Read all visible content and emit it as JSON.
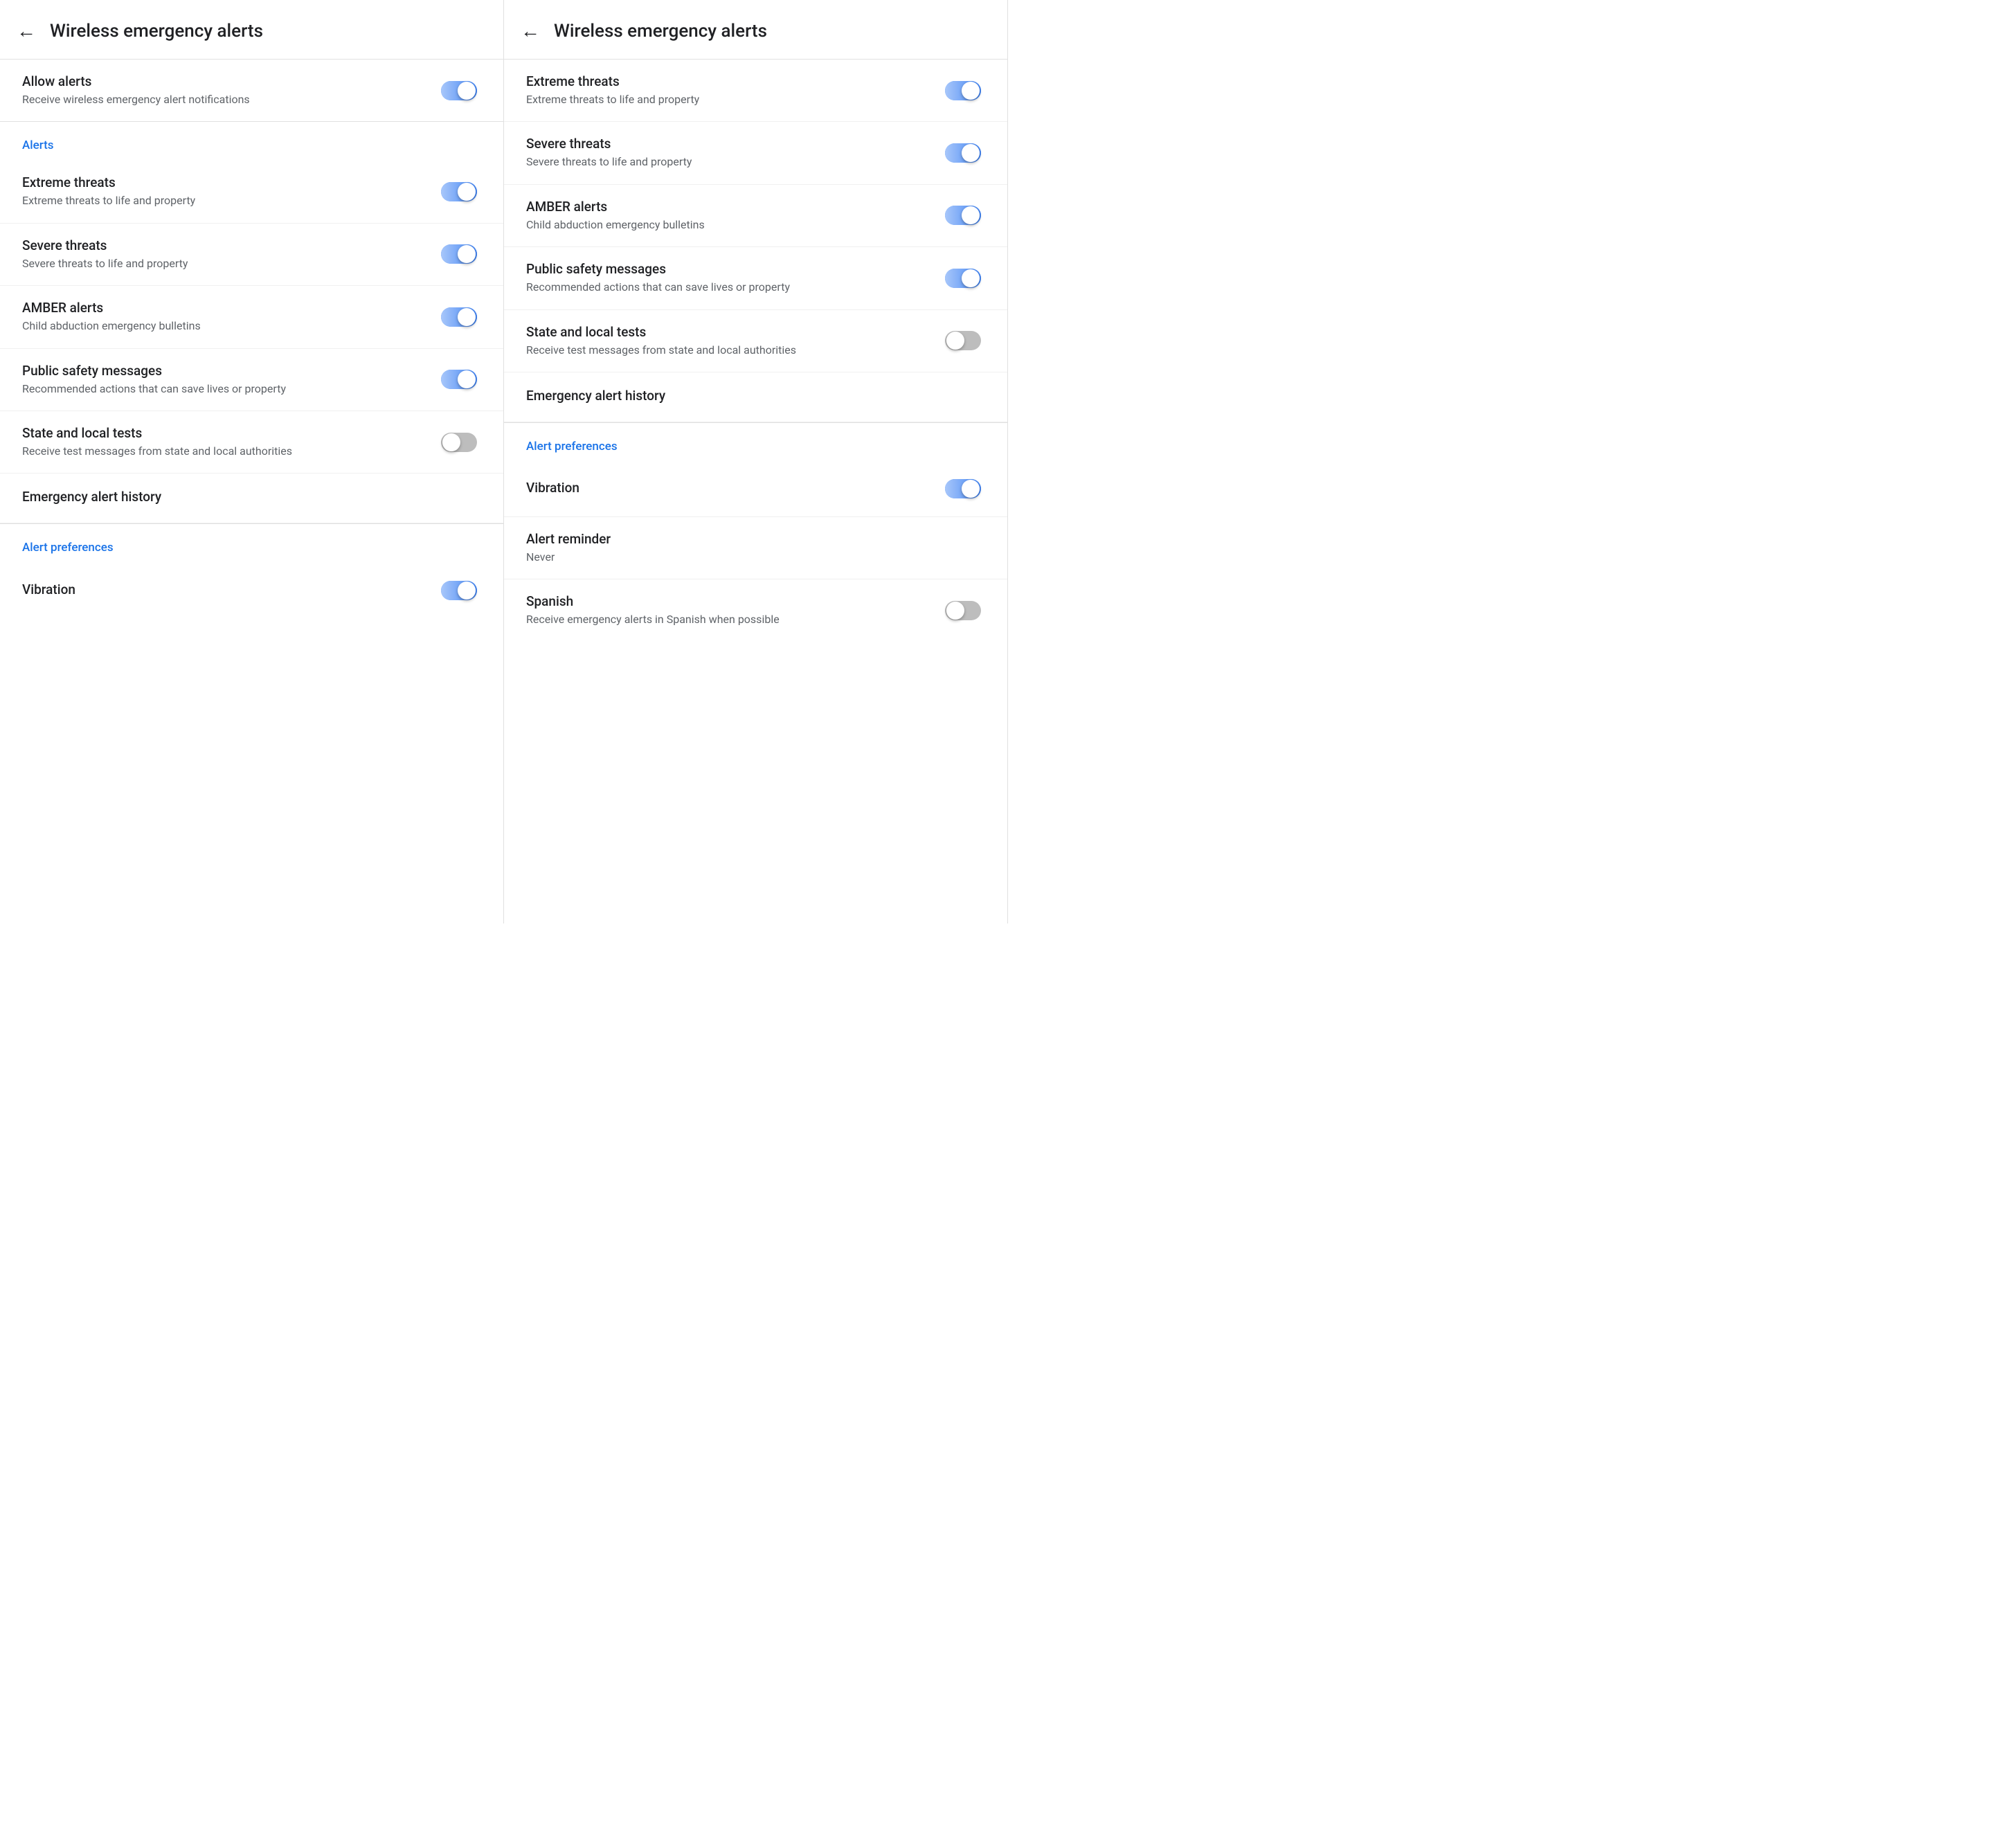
{
  "panels": [
    {
      "id": "panel-left",
      "header": {
        "back_label": "←",
        "title": "Wireless emergency alerts"
      },
      "sections": [
        {
          "id": "allow-section",
          "rows": [
            {
              "id": "allow-alerts",
              "title": "Allow alerts",
              "desc": "Receive wireless emergency alert notifications",
              "toggle": true,
              "toggle_on": true
            }
          ]
        },
        {
          "id": "alerts-section",
          "label": "Alerts",
          "rows": [
            {
              "id": "extreme-threats",
              "title": "Extreme threats",
              "desc": "Extreme threats to life and property",
              "toggle": true,
              "toggle_on": true
            },
            {
              "id": "severe-threats",
              "title": "Severe threats",
              "desc": "Severe threats to life and property",
              "toggle": true,
              "toggle_on": true
            },
            {
              "id": "amber-alerts",
              "title": "AMBER alerts",
              "desc": "Child abduction emergency bulletins",
              "toggle": true,
              "toggle_on": true
            },
            {
              "id": "public-safety",
              "title": "Public safety messages",
              "desc": "Recommended actions that can save lives or property",
              "toggle": true,
              "toggle_on": true
            },
            {
              "id": "state-local-tests",
              "title": "State and local tests",
              "desc": "Receive test messages from state and local authorities",
              "toggle": true,
              "toggle_on": false
            },
            {
              "id": "emergency-history",
              "title": "Emergency alert history",
              "desc": null,
              "toggle": false
            }
          ]
        },
        {
          "id": "preferences-section",
          "label": "Alert preferences",
          "rows": [
            {
              "id": "vibration",
              "title": "Vibration",
              "desc": null,
              "toggle": true,
              "toggle_on": true
            }
          ]
        }
      ]
    },
    {
      "id": "panel-right",
      "header": {
        "back_label": "←",
        "title": "Wireless emergency alerts"
      },
      "sections": [
        {
          "id": "alerts-section-r",
          "rows": [
            {
              "id": "extreme-threats-r",
              "title": "Extreme threats",
              "desc": "Extreme threats to life and property",
              "toggle": true,
              "toggle_on": true
            },
            {
              "id": "severe-threats-r",
              "title": "Severe threats",
              "desc": "Severe threats to life and property",
              "toggle": true,
              "toggle_on": true
            },
            {
              "id": "amber-alerts-r",
              "title": "AMBER alerts",
              "desc": "Child abduction emergency bulletins",
              "toggle": true,
              "toggle_on": true
            },
            {
              "id": "public-safety-r",
              "title": "Public safety messages",
              "desc": "Recommended actions that can save lives or property",
              "toggle": true,
              "toggle_on": true
            },
            {
              "id": "state-local-tests-r",
              "title": "State and local tests",
              "desc": "Receive test messages from state and local authorities",
              "toggle": true,
              "toggle_on": false
            },
            {
              "id": "emergency-history-r",
              "title": "Emergency alert history",
              "desc": null,
              "toggle": false
            }
          ]
        },
        {
          "id": "preferences-section-r",
          "label": "Alert preferences",
          "rows": [
            {
              "id": "vibration-r",
              "title": "Vibration",
              "desc": null,
              "toggle": true,
              "toggle_on": true
            },
            {
              "id": "alert-reminder-r",
              "title": "Alert reminder",
              "desc": "Never",
              "toggle": false
            },
            {
              "id": "spanish-r",
              "title": "Spanish",
              "desc": "Receive emergency alerts in Spanish when possible",
              "toggle": true,
              "toggle_on": false
            }
          ]
        }
      ]
    }
  ]
}
